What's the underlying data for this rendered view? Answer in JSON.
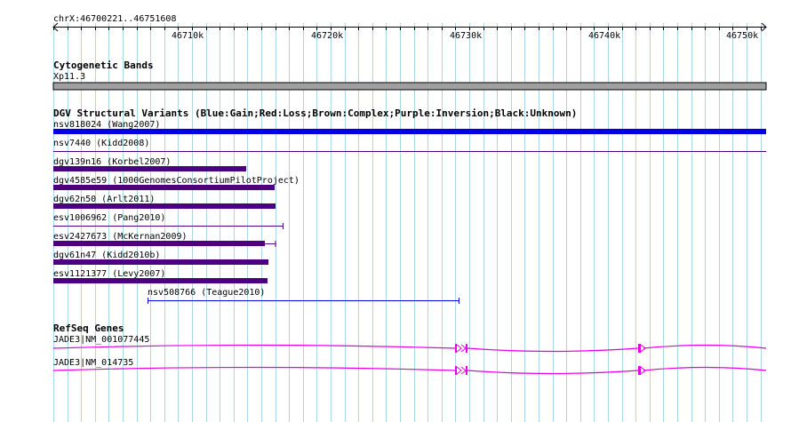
{
  "coordinates": "chrX:46700221..46751608",
  "ruler": {
    "ticks": [
      "46710k",
      "46720k",
      "46730k",
      "46740k",
      "46750k"
    ]
  },
  "tracks": {
    "cytoband": {
      "title": "Cytogenetic Bands",
      "band": "Xp11.3",
      "color": "#a0a0a0"
    },
    "dgv": {
      "title": "DGV Structural Variants (Blue:Gain;Red:Loss;Brown:Complex;Purple:Inversion;Black:Unknown)",
      "colors": {
        "gain": "#0000e6",
        "inversion": "#4b0082"
      },
      "variants": [
        {
          "name": "nsv818024 (Wang2007)",
          "type": "gain"
        },
        {
          "name": "nsv7440 (Kidd2008)",
          "type": "inversion"
        },
        {
          "name": "dgv139n16 (Korbel2007)",
          "type": "inversion"
        },
        {
          "name": "dgv4585e59 (1000GenomesConsortiumPilotProject)",
          "type": "inversion"
        },
        {
          "name": "dgv62n50 (Arlt2011)",
          "type": "inversion"
        },
        {
          "name": "esv1006962 (Pang2010)",
          "type": "inversion"
        },
        {
          "name": "esv2427673 (McKernan2009)",
          "type": "inversion"
        },
        {
          "name": "dgv61n47 (Kidd2010b)",
          "type": "inversion"
        },
        {
          "name": "esv1121377 (Levy2007)",
          "type": "inversion"
        },
        {
          "name": "nsv508766 (Teague2010)",
          "type": "gain"
        }
      ]
    },
    "refseq": {
      "title": "RefSeq Genes",
      "color": "#e600e6",
      "genes": [
        {
          "name": "JADE3|NM_001077445"
        },
        {
          "name": "JADE3|NM_014735"
        }
      ]
    }
  },
  "colors": {
    "grid": "#aed6e6",
    "ruler": "#000000"
  }
}
